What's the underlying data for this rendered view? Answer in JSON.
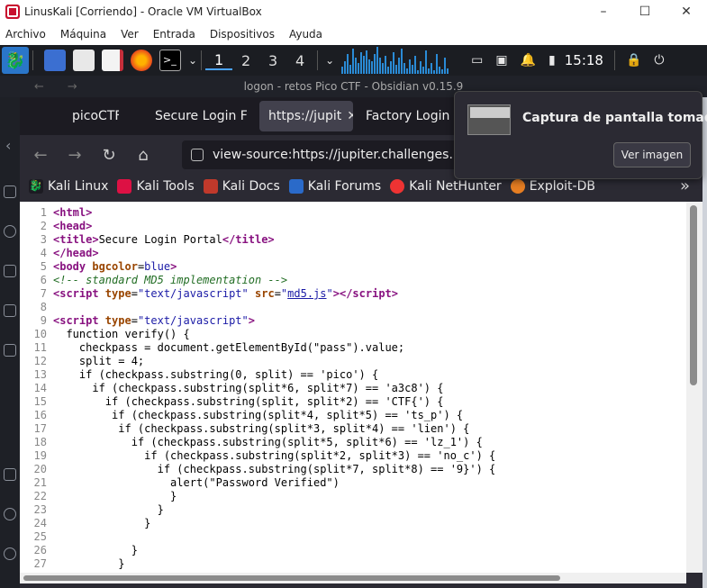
{
  "vbox": {
    "title": "LinusKali [Corriendo] - Oracle VM VirtualBox",
    "menu": [
      "Archivo",
      "Máquina",
      "Ver",
      "Entrada",
      "Dispositivos",
      "Ayuda"
    ],
    "minimize": "–",
    "maximize": "☐",
    "close": "✕"
  },
  "panel": {
    "workspaces": [
      "1",
      "2",
      "3",
      "4"
    ],
    "active_workspace": "1",
    "clock": "15:18"
  },
  "obsidian": {
    "title": "logon - retos Pico CTF - Obsidian v0.15.9"
  },
  "browser": {
    "tabs": [
      {
        "label": "picoCTF -",
        "active": false
      },
      {
        "label": "Secure Login F",
        "active": false
      },
      {
        "label": "https://jupit",
        "active": true
      },
      {
        "label": "Factory Login",
        "active": false
      }
    ],
    "tab_close": "✕",
    "url": "view-source:https://jupiter.challenges.picoctf.o",
    "bookmarks": [
      "Kali Linux",
      "Kali Tools",
      "Kali Docs",
      "Kali Forums",
      "Kali NetHunter",
      "Exploit-DB"
    ],
    "bookmarks_more": "»"
  },
  "notification": {
    "title": "Captura de pantalla tomada",
    "button": "Ver imagen"
  },
  "source_lines": [
    {
      "n": "1",
      "html": "<span class='tag'>&lt;html&gt;</span>"
    },
    {
      "n": "2",
      "html": "<span class='tag'>&lt;head&gt;</span>"
    },
    {
      "n": "3",
      "html": "<span class='tag'>&lt;title&gt;</span>Secure Login Portal<span class='tag'>&lt;/title&gt;</span>"
    },
    {
      "n": "4",
      "html": "<span class='tag'>&lt;/head&gt;</span>"
    },
    {
      "n": "5",
      "html": "<span class='tag'>&lt;body </span><span class='attr'>bgcolor</span>=<span class='val'>blue</span><span class='tag'>&gt;</span>"
    },
    {
      "n": "6",
      "html": "<span class='cmt'>&lt;!-- standard MD5 implementation --&gt;</span>"
    },
    {
      "n": "7",
      "html": "<span class='tag'>&lt;script </span><span class='attr'>type</span>=<span class='val'>\"text/javascript\"</span> <span class='attr'>src</span>=<span class='val'>\"<span class='link'>md5.js</span>\"</span><span class='tag'>&gt;&lt;/script&gt;</span>"
    },
    {
      "n": "8",
      "html": ""
    },
    {
      "n": "9",
      "html": "<span class='tag'>&lt;script </span><span class='attr'>type</span>=<span class='val'>\"text/javascript\"</span><span class='tag'>&gt;</span>"
    },
    {
      "n": "10",
      "html": "  function verify() {"
    },
    {
      "n": "11",
      "html": "    checkpass = document.getElementById(\"pass\").value;"
    },
    {
      "n": "12",
      "html": "    split = 4;"
    },
    {
      "n": "13",
      "html": "    if (checkpass.substring(0, split) == 'pico') {"
    },
    {
      "n": "14",
      "html": "      if (checkpass.substring(split*6, split*7) == 'a3c8') {"
    },
    {
      "n": "15",
      "html": "        if (checkpass.substring(split, split*2) == 'CTF{') {"
    },
    {
      "n": "16",
      "html": "         if (checkpass.substring(split*4, split*5) == 'ts_p') {"
    },
    {
      "n": "17",
      "html": "          if (checkpass.substring(split*3, split*4) == 'lien') {"
    },
    {
      "n": "18",
      "html": "            if (checkpass.substring(split*5, split*6) == 'lz_1') {"
    },
    {
      "n": "19",
      "html": "              if (checkpass.substring(split*2, split*3) == 'no_c') {"
    },
    {
      "n": "20",
      "html": "                if (checkpass.substring(split*7, split*8) == '9}') {"
    },
    {
      "n": "21",
      "html": "                  alert(\"Password Verified\")"
    },
    {
      "n": "22",
      "html": "                  }"
    },
    {
      "n": "23",
      "html": "                }"
    },
    {
      "n": "24",
      "html": "              }"
    },
    {
      "n": "25",
      "html": ""
    },
    {
      "n": "26",
      "html": "            }"
    },
    {
      "n": "27",
      "html": "          }"
    }
  ]
}
